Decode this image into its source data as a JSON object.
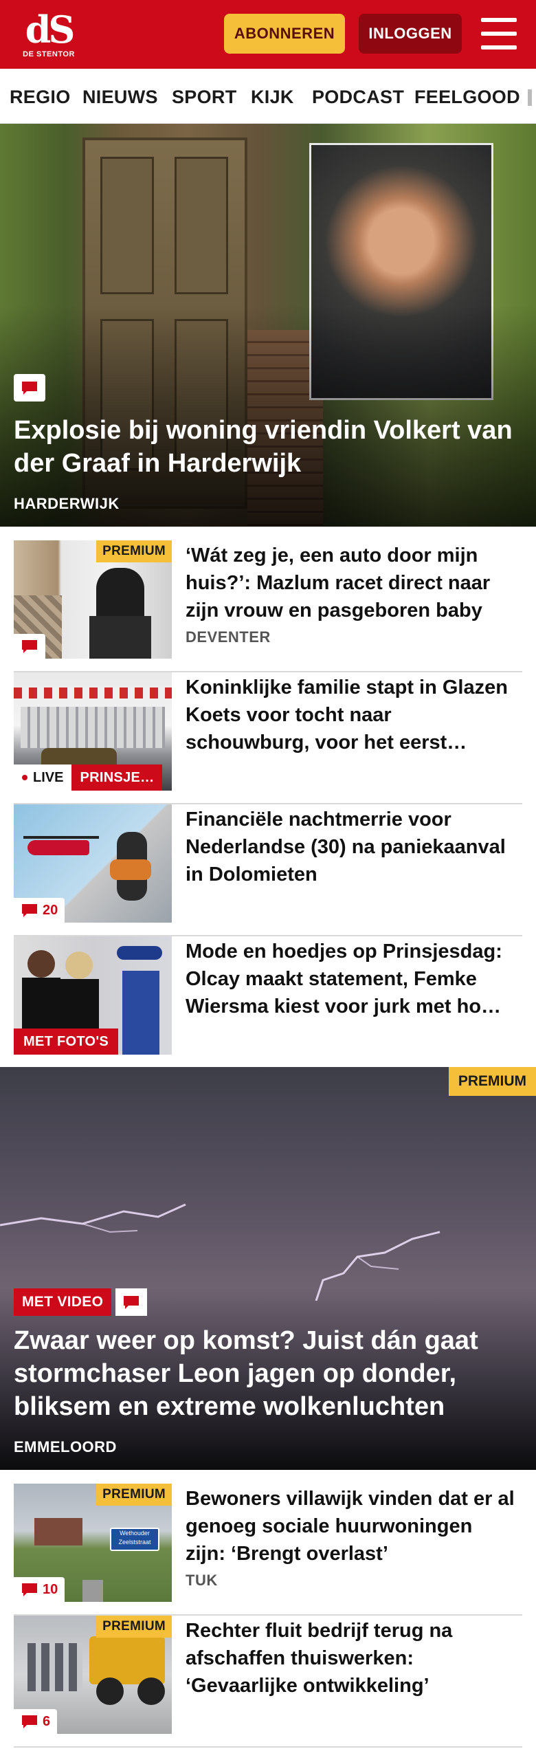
{
  "header": {
    "logo_mark": "dS",
    "logo_text": "DE STENTOR",
    "subscribe_label": "ABONNEREN",
    "login_label": "INLOGGEN",
    "menu_icon": "hamburger-menu-icon",
    "brand_color": "#cc0a19",
    "accent_color": "#f6bf3a"
  },
  "nav": {
    "items": [
      "REGIO",
      "NIEUWS",
      "SPORT",
      "KIJK",
      "PODCAST",
      "FEELGOOD"
    ]
  },
  "hero": {
    "title": "Explosie bij woning vriendin Volkert van der Graaf in Harderwijk",
    "kicker": "HARDERWIJK",
    "icon": "comment-icon"
  },
  "articles": [
    {
      "title": "‘Wát zeg je, een auto door mijn huis?’: Mazlum racet direct naar zijn vrouw en pasgeboren baby",
      "kicker": "DEVENTER",
      "premium": "PREMIUM"
    },
    {
      "title": "Koninklijke familie stapt in Glazen Koets voor tocht naar schouwburg, voor het eerst…",
      "live_label": "LIVE",
      "live_topic": "PRINSJE…"
    },
    {
      "title": "Financiële nachtmerrie voor Nederlandse (30) na paniekaan­val in Dolomieten",
      "comments": "20"
    },
    {
      "title": "Mode en hoedjes op Prinsjesdag: Olcay maakt statement, Femke Wiersma kiest voor jurk met ho…",
      "label": "MET FOTO'S"
    }
  ],
  "storm": {
    "premium": "PREMIUM",
    "video_label": "MET VIDEO",
    "title": "Zwaar weer op komst? Juist dán gaat stormchaser Leon jagen op donder, bliksem en extreme wolkenluchten",
    "kicker": "EMMELOORD"
  },
  "articles2": [
    {
      "title": "Bewoners villawijk vinden dat er al genoeg sociale huurwoningen zijn: ‘Brengt overlast’",
      "kicker": "TUK",
      "premium": "PREMIUM",
      "comments": "10",
      "sign_text": "Wethouder Zeelststraat"
    },
    {
      "title": "Rechter fluit bedrijf terug na afschaffen thuiswerken: ‘Gevaarlijke ontwikkeling’",
      "premium": "PREMIUM",
      "comments": "6"
    }
  ]
}
